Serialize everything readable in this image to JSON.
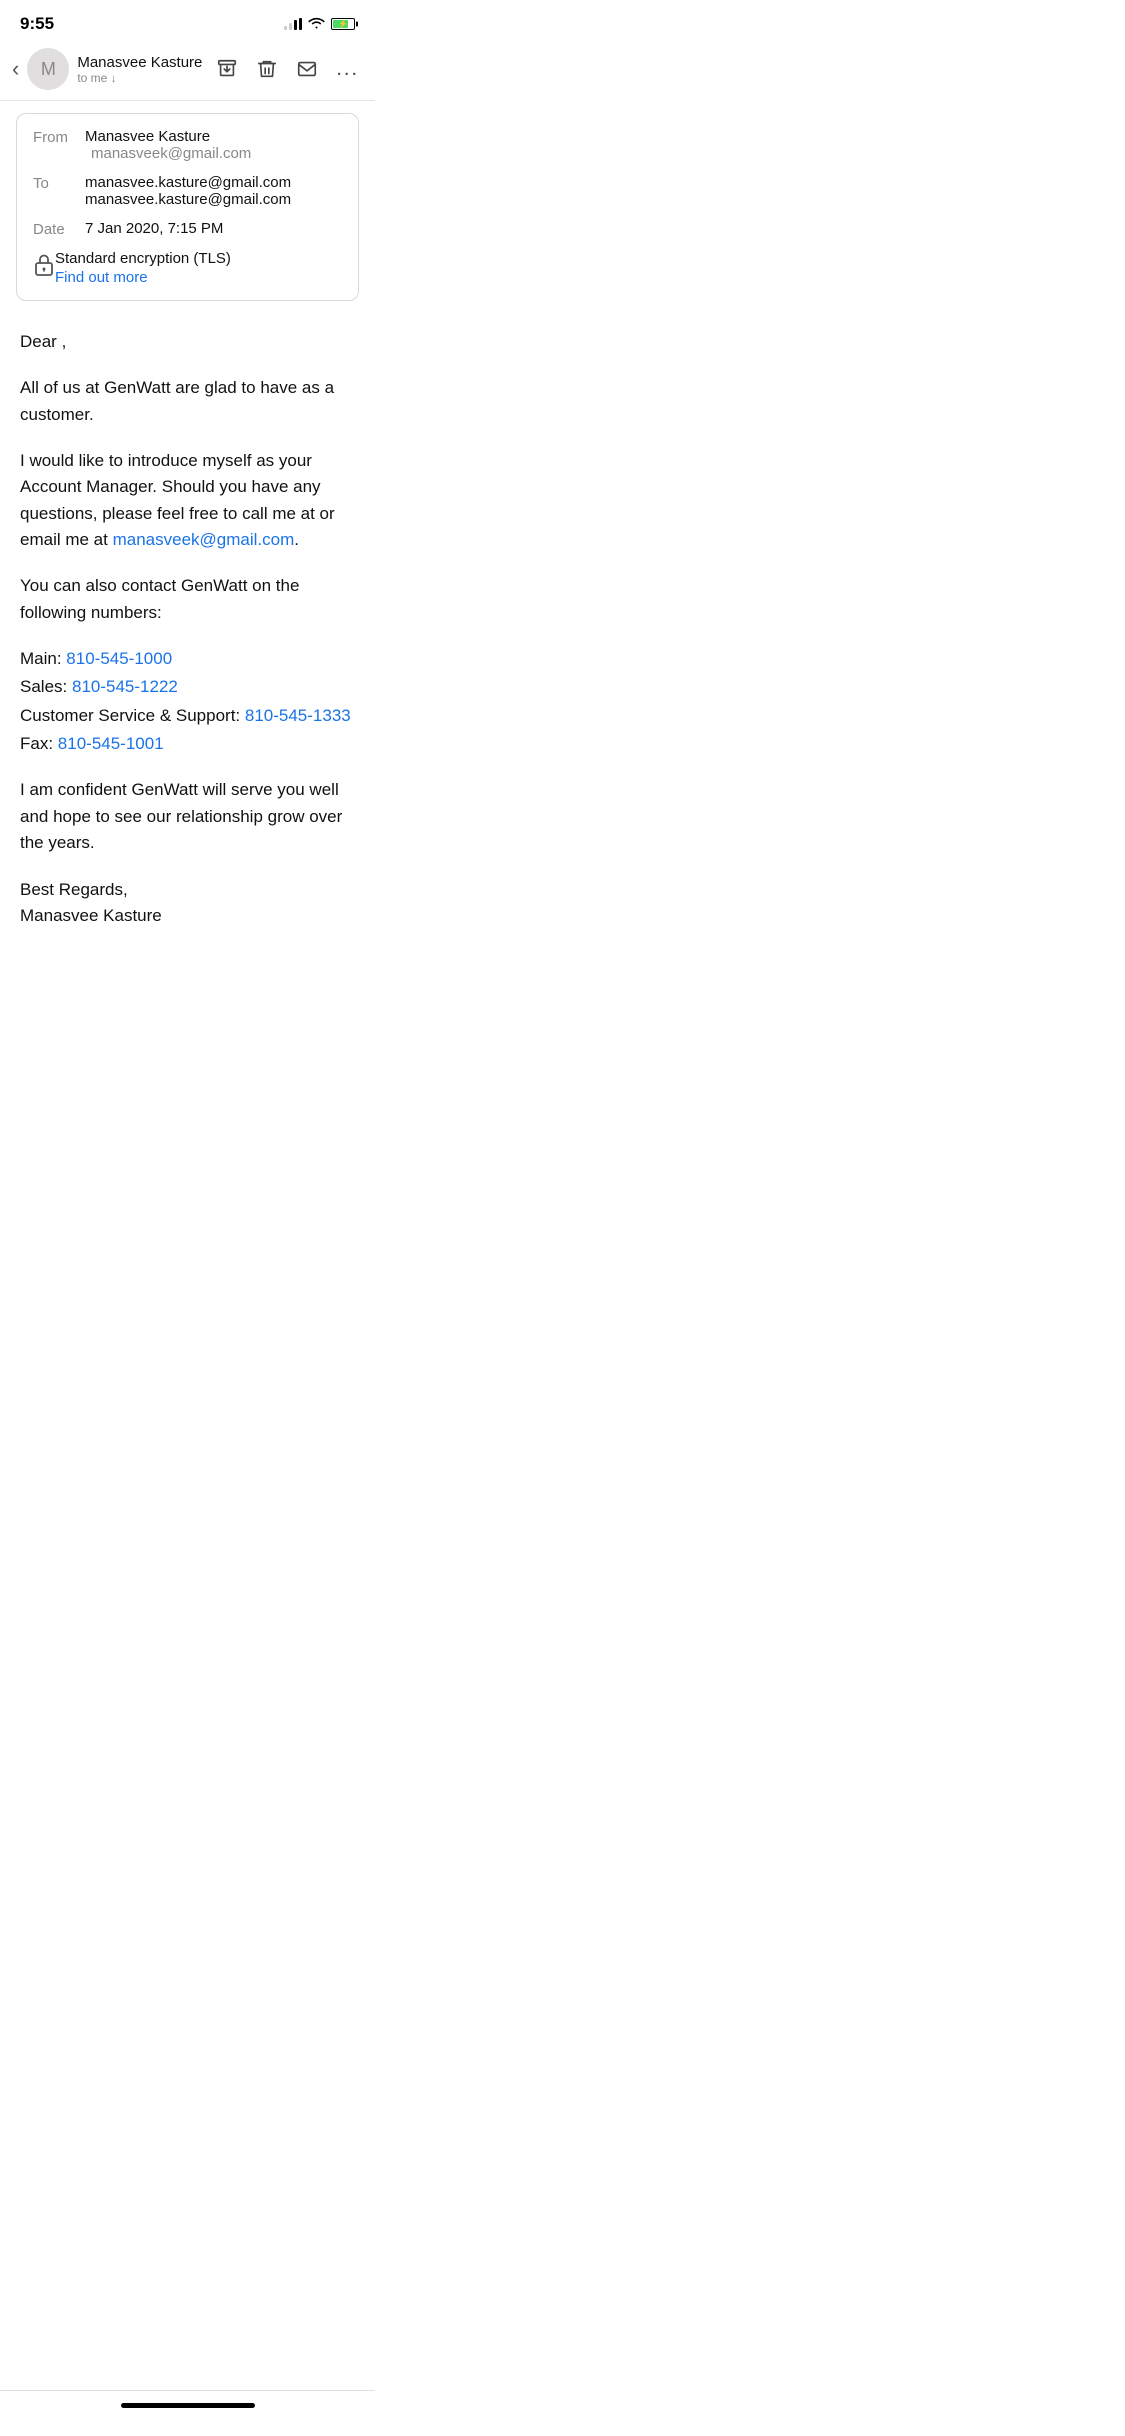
{
  "statusBar": {
    "time": "9:55"
  },
  "emailHeader": {
    "senderInitial": "M",
    "senderName": "Manasvee Kasture",
    "senderSub": "to me ↓",
    "actions": {
      "archive": "archive-icon",
      "delete": "delete-icon",
      "mail": "mail-icon",
      "more": "..."
    }
  },
  "emailMeta": {
    "fromLabel": "From",
    "fromName": "Manasvee Kasture",
    "fromEmail": "manasveek@gmail.com",
    "toLabel": "To",
    "toEmail1": "manasvee.kasture@gmail.com",
    "toEmail2": "manasvee.kasture@gmail.com",
    "dateLabel": "Date",
    "dateValue": "7 Jan 2020, 7:15 PM",
    "encryptionLabel": "Standard encryption (TLS)",
    "findOutMore": "Find out more"
  },
  "emailBody": {
    "greeting": "Dear ,",
    "para1": "All of us at GenWatt are glad to have  as a customer.",
    "para2_start": "I would like to introduce myself as your Account Manager.  Should you have any questions, please feel free to call me at  or email me at ",
    "para2_email": "manasveek@gmail.com",
    "para2_end": ".",
    "para3": "You can also contact GenWatt on the following numbers:",
    "mainLabel": "Main: ",
    "mainPhone": "810-545-1000",
    "salesLabel": "Sales: ",
    "salesPhone": "810-545-1222",
    "csLabel": "Customer Service & Support: ",
    "csPhone": "810-545-1333",
    "faxLabel": "Fax: ",
    "faxPhone": "810-545-1001",
    "para4": "I am confident GenWatt will serve you well and hope to see our relationship grow over the years.",
    "closing": "Best Regards,",
    "closingName": "Manasvee Kasture"
  }
}
